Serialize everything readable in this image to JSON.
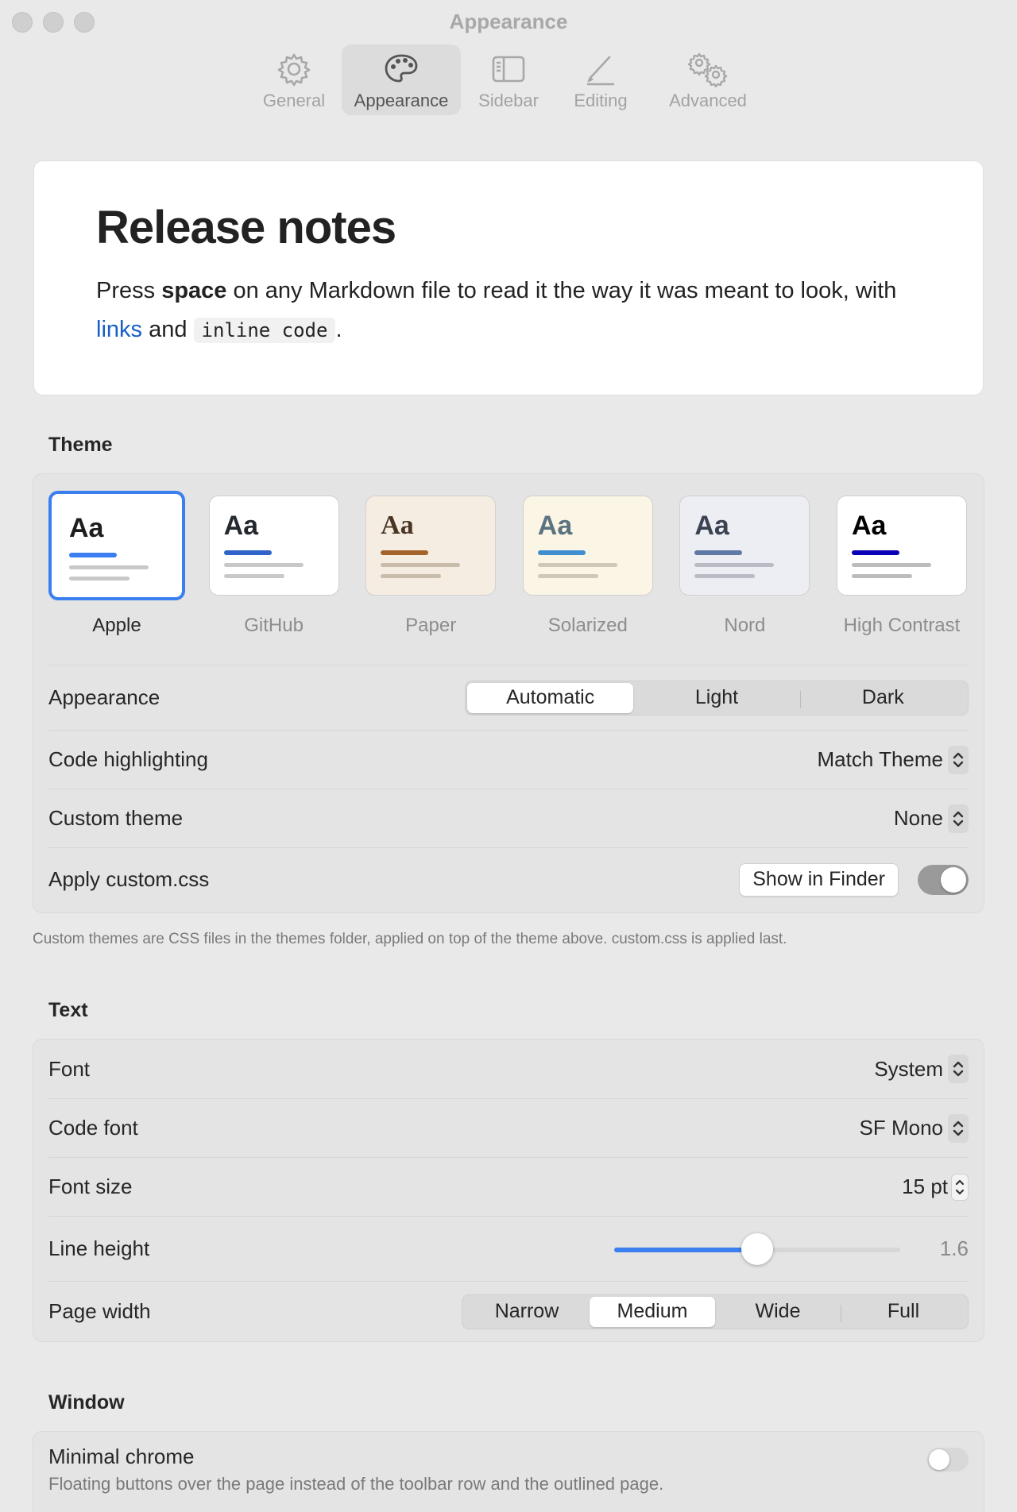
{
  "window": {
    "title": "Appearance"
  },
  "toolbar": {
    "tabs": [
      {
        "label": "General",
        "icon": "gear-icon"
      },
      {
        "label": "Appearance",
        "icon": "palette-icon"
      },
      {
        "label": "Sidebar",
        "icon": "sidebar-icon"
      },
      {
        "label": "Editing",
        "icon": "pencil-icon"
      },
      {
        "label": "Advanced",
        "icon": "gears-icon"
      }
    ],
    "selected": "Appearance"
  },
  "preview": {
    "heading": "Release notes",
    "text_1": "Press ",
    "bold": "space",
    "text_2": " on any Markdown file to read it the way it was meant to look, with ",
    "link": "links",
    "text_3": " and ",
    "code": "inline code",
    "text_4": "."
  },
  "theme": {
    "section_title": "Theme",
    "glyph": "Aa",
    "tiles": [
      {
        "name": "Apple",
        "selected": true,
        "bg": "#ffffff",
        "fg": "#1d1d1f",
        "accent": "#3a7ef0",
        "line": "#c8c8c8"
      },
      {
        "name": "GitHub",
        "selected": false,
        "bg": "#ffffff",
        "fg": "#24292f",
        "accent": "#2f63c9",
        "line": "#c8c8c8"
      },
      {
        "name": "Paper",
        "selected": false,
        "bg": "#f5ede1",
        "fg": "#4a3524",
        "accent": "#a5632c",
        "line": "#c9bcab"
      },
      {
        "name": "Solarized",
        "selected": false,
        "bg": "#fbf5e6",
        "fg": "#5b7380",
        "accent": "#3f8fd0",
        "line": "#cfc8b8"
      },
      {
        "name": "Nord",
        "selected": false,
        "bg": "#eceef3",
        "fg": "#3b4252",
        "accent": "#5e7aa4",
        "line": "#b9bcc4"
      },
      {
        "name": "High Contrast",
        "selected": false,
        "bg": "#ffffff",
        "fg": "#000000",
        "accent": "#0a00b5",
        "line": "#bcbcbc"
      }
    ],
    "appearance_label": "Appearance",
    "appearance_options": [
      "Automatic",
      "Light",
      "Dark"
    ],
    "appearance_selected": "Automatic",
    "code_highlighting_label": "Code highlighting",
    "code_highlighting_value": "Match Theme",
    "custom_theme_label": "Custom theme",
    "custom_theme_value": "None",
    "apply_css_label": "Apply custom.css",
    "show_in_finder": "Show in Finder",
    "apply_css_on": true,
    "note": "Custom themes are CSS files in the themes folder, applied on top of the theme above. custom.css is applied last."
  },
  "text": {
    "section_title": "Text",
    "font_label": "Font",
    "font_value": "System",
    "code_font_label": "Code font",
    "code_font_value": "SF Mono",
    "font_size_label": "Font size",
    "font_size_value": "15 pt",
    "line_height_label": "Line height",
    "line_height_value": "1.6",
    "line_height_fraction": 0.5,
    "page_width_label": "Page width",
    "page_width_options": [
      "Narrow",
      "Medium",
      "Wide",
      "Full"
    ],
    "page_width_selected": "Medium"
  },
  "window_section": {
    "section_title": "Window",
    "minimal_chrome_label": "Minimal chrome",
    "minimal_chrome_desc": "Floating buttons over the page instead of the toolbar row and the outlined page.",
    "minimal_chrome_on": false
  },
  "colors": {
    "accent": "#3a7ef0",
    "toggle_on": "#9a9a9a",
    "toggle_off": "#d8d8d8"
  }
}
